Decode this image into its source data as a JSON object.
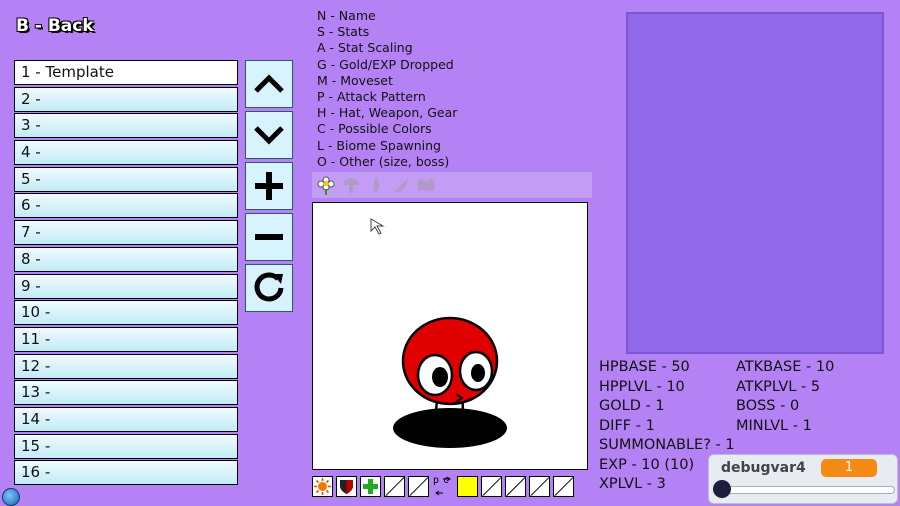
{
  "back_label": "B - Back",
  "list_items": [
    "1 - Template",
    "2 -",
    "3 -",
    "4 -",
    "5 -",
    "6 -",
    "7 -",
    "8 -",
    "9 -",
    "10 -",
    "11 -",
    "12 -",
    "13 -",
    "14 -",
    "15 -",
    "16 -"
  ],
  "key_help": [
    "N - Name",
    "S - Stats",
    "A - Stat Scaling",
    "G - Gold/EXP Dropped",
    "M - Moveset",
    "P - Attack Pattern",
    "H - Hat, Weapon, Gear",
    "C - Possible Colors",
    "L - Biome Spawning",
    "O - Other (size, boss)"
  ],
  "stats": {
    "hpbase": "HPBASE - 50",
    "atkbase": "ATKBASE - 10",
    "hpplvl": "HPPLVL - 10",
    "atkplvl": "ATKPLVL - 5",
    "gold": "GOLD - 1",
    "boss": "BOSS - 0",
    "diff": "DIFF - 1",
    "minlvl": "MINLVL - 1",
    "summonable": "SUMMONABLE? - 1",
    "exp": "EXP - 10 (10)",
    "xplvl": "XPLVL - 3"
  },
  "debug_var": {
    "name": "debugvar4",
    "value": "1",
    "slider_fraction": 0.0
  },
  "bottom_bar_pc_label": "pc",
  "colors": {
    "background": "#b482f4",
    "preview": "#9068ea",
    "creature": "#e00000",
    "swatch_yellow": "#ffff00"
  }
}
